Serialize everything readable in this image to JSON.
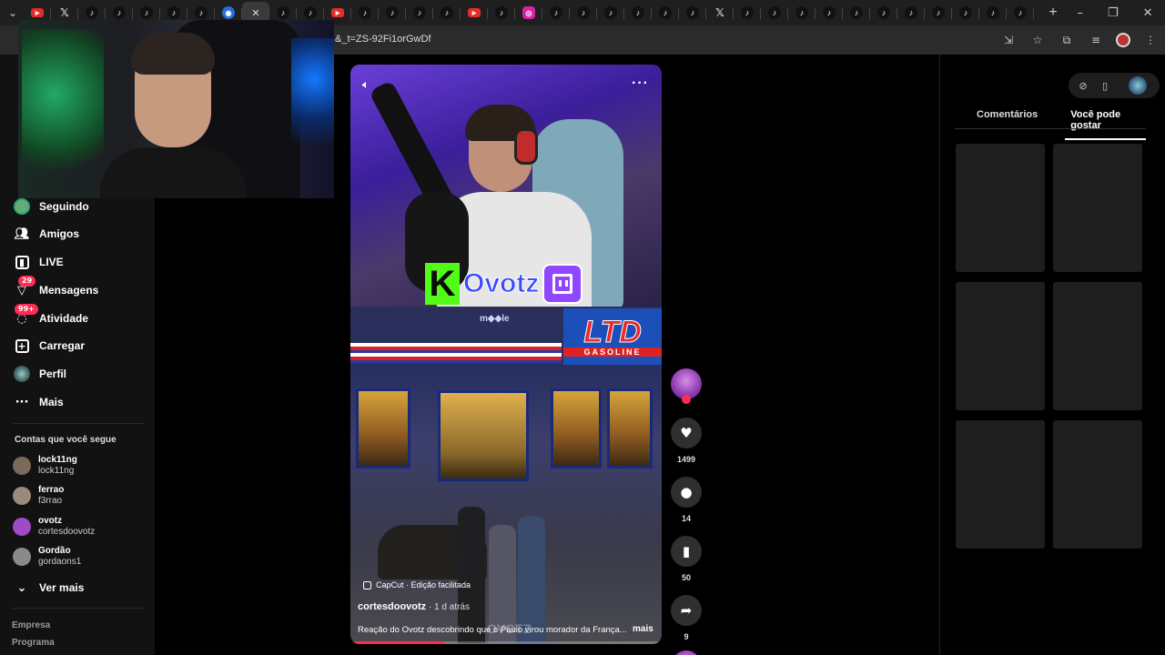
{
  "browser": {
    "url_fragment": "&_t=ZS-92Fi1orGwDf",
    "tabs": [
      {
        "icon": "youtube-icon",
        "type": "yt"
      },
      {
        "icon": "x-icon",
        "type": "x"
      },
      {
        "icon": "tiktok-icon",
        "type": "tk"
      },
      {
        "icon": "tiktok-icon",
        "type": "tk"
      },
      {
        "icon": "tiktok-icon",
        "type": "tk"
      },
      {
        "icon": "tiktok-icon",
        "type": "tk"
      },
      {
        "icon": "tiktok-icon",
        "type": "tk"
      },
      {
        "icon": "blue-icon",
        "type": "blue"
      },
      {
        "icon": "close-icon",
        "type": "active"
      },
      {
        "icon": "tiktok-icon",
        "type": "tk"
      },
      {
        "icon": "tiktok-icon",
        "type": "tk"
      },
      {
        "icon": "youtube-icon",
        "type": "yt"
      },
      {
        "icon": "tiktok-icon",
        "type": "tk"
      },
      {
        "icon": "tiktok-icon",
        "type": "tk"
      },
      {
        "icon": "tiktok-icon",
        "type": "tk"
      },
      {
        "icon": "tiktok-icon",
        "type": "tk"
      },
      {
        "icon": "youtube-icon",
        "type": "yt"
      },
      {
        "icon": "tiktok-icon",
        "type": "tk"
      },
      {
        "icon": "instagram-icon",
        "type": "ig"
      },
      {
        "icon": "tiktok-icon",
        "type": "tk"
      },
      {
        "icon": "tiktok-icon",
        "type": "tk"
      },
      {
        "icon": "tiktok-icon",
        "type": "tk"
      },
      {
        "icon": "tiktok-icon",
        "type": "tk"
      },
      {
        "icon": "tiktok-icon",
        "type": "tk"
      },
      {
        "icon": "tiktok-icon",
        "type": "tk"
      },
      {
        "icon": "x-icon",
        "type": "x"
      },
      {
        "icon": "tiktok-icon",
        "type": "tk"
      },
      {
        "icon": "tiktok-icon",
        "type": "tk"
      },
      {
        "icon": "tiktok-icon",
        "type": "tk"
      },
      {
        "icon": "tiktok-icon",
        "type": "tk"
      },
      {
        "icon": "tiktok-icon",
        "type": "tk"
      },
      {
        "icon": "tiktok-icon",
        "type": "tk"
      },
      {
        "icon": "tiktok-icon",
        "type": "tk"
      },
      {
        "icon": "tiktok-icon",
        "type": "tk"
      },
      {
        "icon": "tiktok-icon",
        "type": "tk"
      },
      {
        "icon": "tiktok-icon",
        "type": "tk"
      },
      {
        "icon": "tiktok-icon",
        "type": "tk"
      }
    ],
    "new_tab": "+",
    "window_controls": [
      "–",
      "❐",
      "✕"
    ]
  },
  "sidebar": {
    "nav": [
      {
        "label": "Seguindo",
        "icon": "following-avatar-icon"
      },
      {
        "label": "Amigos",
        "icon": "friends-icon"
      },
      {
        "label": "LIVE",
        "icon": "live-icon"
      },
      {
        "label": "Mensagens",
        "icon": "messages-icon",
        "badge": "29"
      },
      {
        "label": "Atividade",
        "icon": "activity-icon",
        "badge": "99+"
      },
      {
        "label": "Carregar",
        "icon": "upload-icon"
      },
      {
        "label": "Perfil",
        "icon": "profile-avatar-icon"
      },
      {
        "label": "Mais",
        "icon": "more-dots-icon"
      }
    ],
    "following_title": "Contas que você segue",
    "accounts": [
      {
        "name": "lock11ng",
        "user": "lock11ng",
        "color": "#7a6a5a"
      },
      {
        "name": "ferrao",
        "user": "f3rrao",
        "color": "#9a8a7a"
      },
      {
        "name": "ovotz",
        "user": "cortesdoovotz",
        "color": "#a04ac8"
      },
      {
        "name": "Gordão",
        "user": "gordaons1",
        "color": "#8a8a8a"
      }
    ],
    "see_more": "Ver mais",
    "footer": [
      "Empresa",
      "Programa"
    ]
  },
  "video": {
    "overlay_brand": "Ovotz",
    "kick_letter": "K",
    "store_sign": "LTD",
    "store_sub": "GASOLINE",
    "capcut_label": "CapCut · Edição facilitada",
    "author": "cortesdoovotz",
    "posted": " · 1 d atrás",
    "description": "Reação do Ovotz descobrindo que o Paulo virou morador da França...",
    "more_label": "mais",
    "watermark": "OVOTZ",
    "progress": 0.3
  },
  "actions": {
    "likes": "1499",
    "comments": "14",
    "saves": "50",
    "shares": "9"
  },
  "right_panel": {
    "tab_comments": "Comentários",
    "tab_suggest": "Você pode gostar",
    "placeholders": 6
  },
  "colors": {
    "accent": "#fe2c55",
    "kick_green": "#53fc18",
    "twitch_purple": "#9146ff"
  }
}
